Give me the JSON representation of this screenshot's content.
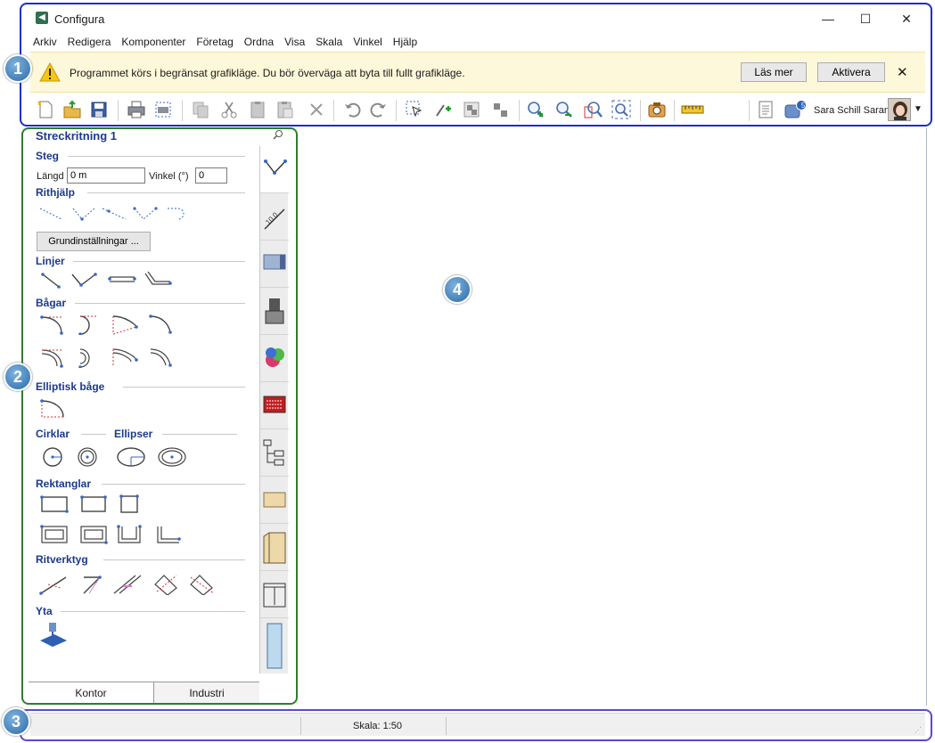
{
  "window": {
    "title": "Configura",
    "minimize": "—",
    "maximize": "☐",
    "close": "✕"
  },
  "menu": [
    "Arkiv",
    "Redigera",
    "Komponenter",
    "Företag",
    "Ordna",
    "Visa",
    "Skala",
    "Vinkel",
    "Hjälp"
  ],
  "notification": {
    "text": "Programmet körs i begränsat grafikläge. Du bör överväga att byta till fullt grafikläge.",
    "read_more": "Läs mer",
    "activate": "Aktivera",
    "close": "✕",
    "icon": "warning-icon"
  },
  "toolbar": {
    "icons": [
      "new-icon",
      "open-icon",
      "save-icon",
      "print-icon",
      "print-preview-icon",
      "copy-icon",
      "cut-icon",
      "paste-icon",
      "paste-special-icon",
      "delete-icon",
      "undo-icon",
      "redo-icon",
      "select-icon",
      "insert-icon",
      "group-icon",
      "ungroup-icon",
      "zoom-in-icon",
      "zoom-out-icon",
      "zoom-window-icon",
      "zoom-extents-icon",
      "camera-icon",
      "ruler-icon",
      "report-icon",
      "messages-icon"
    ],
    "notifications_count": "5",
    "user_name": "Sara Schill Saran"
  },
  "panel": {
    "title": "Streckritning 1",
    "steg": {
      "heading": "Steg",
      "length_label": "Längd",
      "length_value": "0 m",
      "angle_label": "Vinkel (°)",
      "angle_value": "0"
    },
    "rithjalp": {
      "heading": "Rithjälp",
      "button": "Grundinställningar ..."
    },
    "sections": {
      "linjer": "Linjer",
      "bagar": "Bågar",
      "elliptisk": "Elliptisk båge",
      "cirklar": "Cirklar",
      "ellipser": "Ellipser",
      "rektanglar": "Rektanglar",
      "ritverktyg": "Ritverktyg",
      "yta": "Yta"
    },
    "tabs": [
      "Kontor",
      "Industri"
    ]
  },
  "side_tabs": [
    "polyline-tab-icon",
    "dimension-tab-icon",
    "wall-tab-icon",
    "furniture-tab-icon",
    "material-tab-icon",
    "catalog-tab-icon",
    "tree-tab-icon",
    "board-tab-icon",
    "cabinet-tab-icon",
    "storage-tab-icon",
    "panel-tab-icon"
  ],
  "status": {
    "scale": "Skala: 1:50"
  },
  "badges": [
    "1",
    "2",
    "3",
    "4"
  ],
  "colors": {
    "accent": "#1b3a8c",
    "frame1": "#1a2fc7",
    "frame2": "#2e7d2e",
    "frame3": "#5a4bd0",
    "notify_bg": "#fdf8d9"
  }
}
